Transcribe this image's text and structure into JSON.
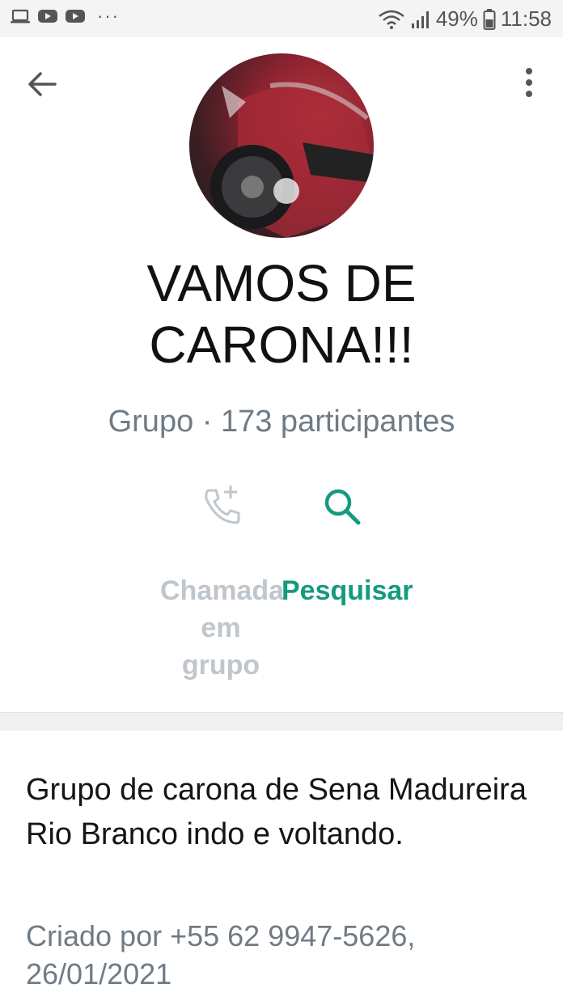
{
  "status_bar": {
    "battery": "49%",
    "time": "11:58",
    "left_icons": [
      "laptop-icon",
      "youtube-icon",
      "youtube-icon"
    ],
    "more": "···"
  },
  "header": {
    "title": "VAMOS DE CARONA!!!",
    "subtitle": "Grupo · 173 participantes",
    "icons": {
      "back": "arrow-left-icon",
      "menu": "more-vert-icon"
    }
  },
  "actions": [
    {
      "label": "Chamada em grupo",
      "icon": "add-call-icon",
      "color": "#bfc6cc",
      "enabled": false
    },
    {
      "label": "Pesquisar",
      "icon": "search-icon",
      "color": "#159a7e",
      "enabled": true
    }
  ],
  "description": {
    "text": "Grupo de carona de Sena Madureira Rio Branco  indo e voltando.",
    "created_by": "Criado por +55 62 9947-5626, 26/01/2021"
  },
  "colors": {
    "accent": "#159a7e",
    "muted": "#6f7b85",
    "disabled": "#bfc6cc"
  }
}
